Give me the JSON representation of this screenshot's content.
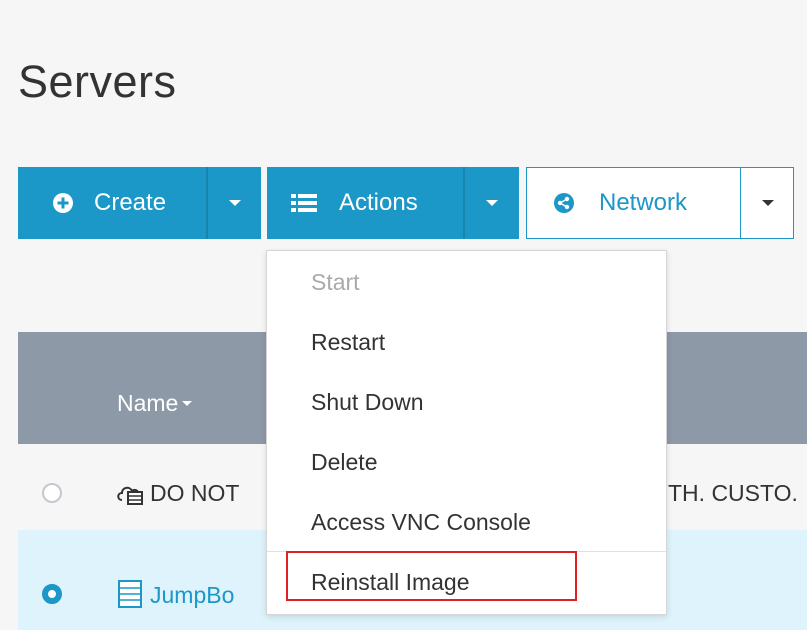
{
  "page": {
    "title": "Servers"
  },
  "toolbar": {
    "create_label": "Create",
    "actions_label": "Actions",
    "network_label": "Network"
  },
  "table": {
    "header_name": "Name",
    "rows": [
      {
        "selected": false,
        "left_text": "DO NOT",
        "right_text": "TH. CUSTO."
      },
      {
        "selected": true,
        "left_text": "JumpBo"
      }
    ]
  },
  "actions_menu": {
    "items": [
      {
        "label": "Start",
        "disabled": true
      },
      {
        "label": "Restart",
        "disabled": false
      },
      {
        "label": "Shut Down",
        "disabled": false
      },
      {
        "label": "Delete",
        "disabled": false
      },
      {
        "label": "Access VNC Console",
        "disabled": false
      },
      {
        "label": "Reinstall Image",
        "disabled": false,
        "highlighted": true
      }
    ]
  },
  "colors": {
    "primary": "#1b97c8",
    "header_bg": "#8e99a8",
    "selected_row": "#def3fb",
    "highlight_border": "#e02020"
  }
}
